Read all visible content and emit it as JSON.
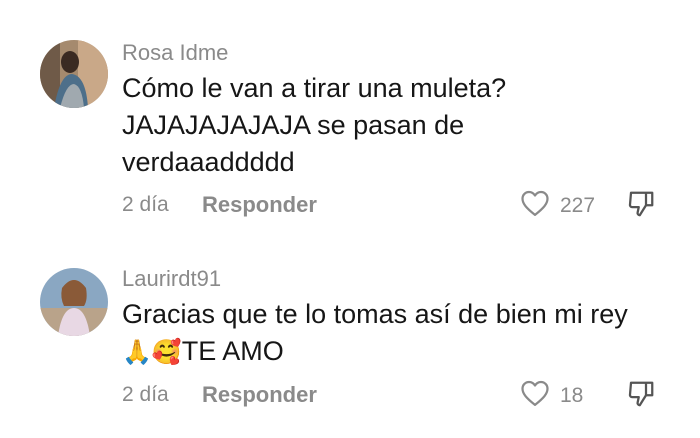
{
  "comments": [
    {
      "username": "Rosa Idme",
      "text_lines": [
        "Cómo le van a tirar una muleta?",
        "JAJAJAJAJAJA se pasan de",
        "verdaaaddddd"
      ],
      "date": "2 día",
      "reply_label": "Responder",
      "likes": "227"
    },
    {
      "username": "Laurirdt91",
      "text_line1": "Gracias que te lo tomas así de bien mi rey",
      "emojis": "🙏🥰",
      "text_line2": "TE AMO",
      "date": "2 día",
      "reply_label": "Responder",
      "likes": "18"
    }
  ],
  "colors": {
    "text": "#161616",
    "secondary": "#8a8a8a"
  },
  "icons": {
    "like": "heart-outline-icon",
    "dislike": "thumbs-down-outline-icon"
  }
}
